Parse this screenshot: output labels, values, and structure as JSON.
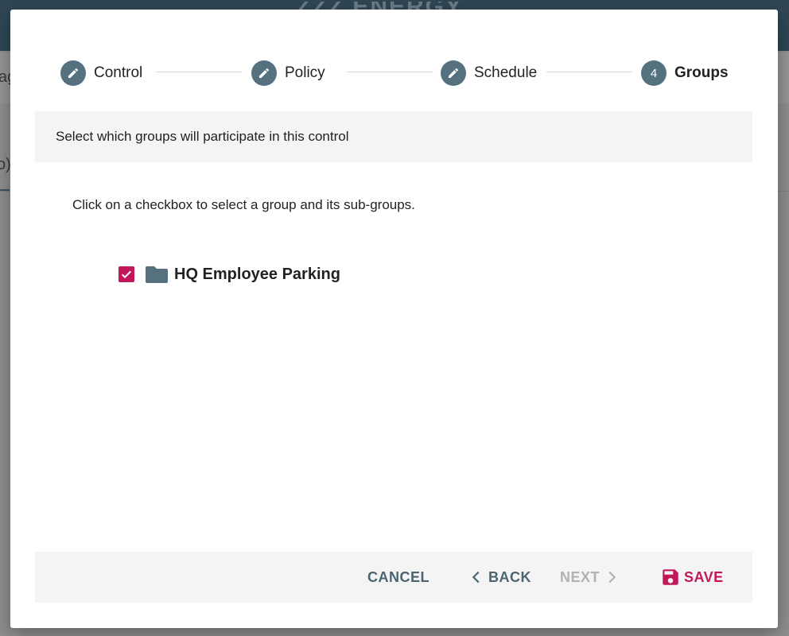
{
  "background": {
    "logo_text": "ZZZ ENERGY",
    "partial_text_1": "ag",
    "partial_text_2": "o)"
  },
  "stepper": {
    "steps": [
      {
        "label": "Control",
        "icon": "pencil-icon",
        "state": "completed"
      },
      {
        "label": "Policy",
        "icon": "pencil-icon",
        "state": "completed"
      },
      {
        "label": "Schedule",
        "icon": "pencil-icon",
        "state": "completed"
      },
      {
        "label": "Groups",
        "number": "4",
        "state": "active"
      }
    ]
  },
  "info_bar": {
    "text": "Select which groups will participate in this control"
  },
  "instruction": "Click on a checkbox to select a group and its sub-groups.",
  "groups": [
    {
      "label": "HQ Employee Parking",
      "checked": true,
      "icon": "folder-icon"
    }
  ],
  "footer": {
    "cancel_label": "CANCEL",
    "back_label": "BACK",
    "next_label": "NEXT",
    "save_label": "SAVE"
  },
  "colors": {
    "primary": "#55707f",
    "accent": "#c2185b",
    "disabled": "#b2b2b2"
  }
}
